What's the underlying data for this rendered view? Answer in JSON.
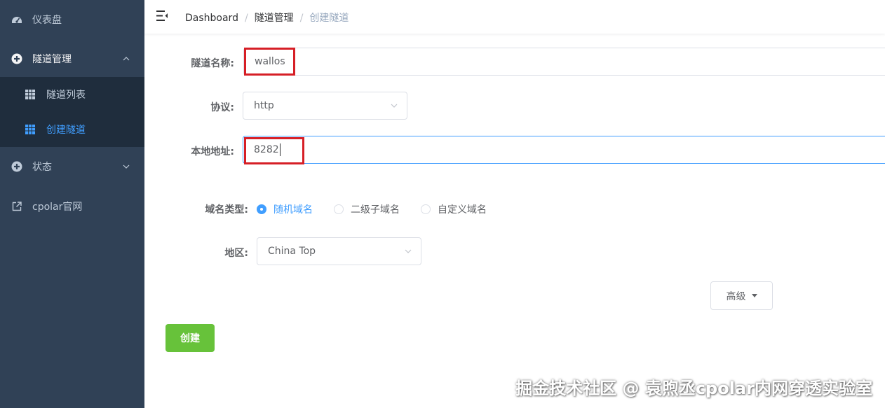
{
  "sidebar": {
    "items": [
      {
        "label": "仪表盘",
        "icon": "dashboard-icon"
      },
      {
        "label": "隧道管理",
        "icon": "circle-dot-icon"
      },
      {
        "label": "隧道列表",
        "icon": "table-icon"
      },
      {
        "label": "创建隧道",
        "icon": "table-icon"
      },
      {
        "label": "状态",
        "icon": "circle-dot-icon"
      },
      {
        "label": "cpolar官网",
        "icon": "external-link-icon"
      }
    ]
  },
  "breadcrumb": {
    "items": [
      "Dashboard",
      "隧道管理",
      "创建隧道"
    ],
    "separator": "/"
  },
  "form": {
    "name_label": "隧道名称:",
    "name_value": "wallos",
    "protocol_label": "协议:",
    "protocol_value": "http",
    "local_label": "本地地址:",
    "local_value": "8282",
    "domain_type_label": "域名类型:",
    "domain_types": [
      "随机域名",
      "二级子域名",
      "自定义域名"
    ],
    "domain_type_selected": "随机域名",
    "region_label": "地区:",
    "region_value": "China Top",
    "advanced_label": "高级",
    "create_label": "创建"
  },
  "watermark": "掘金技术社区 @ 袁煦丞cpolar内网穿透实验室",
  "colors": {
    "sidebar_bg": "#304156",
    "submenu_bg": "#1f2d3d",
    "active": "#409eff",
    "create_button": "#67c23a",
    "highlight_box": "#d61f26"
  }
}
